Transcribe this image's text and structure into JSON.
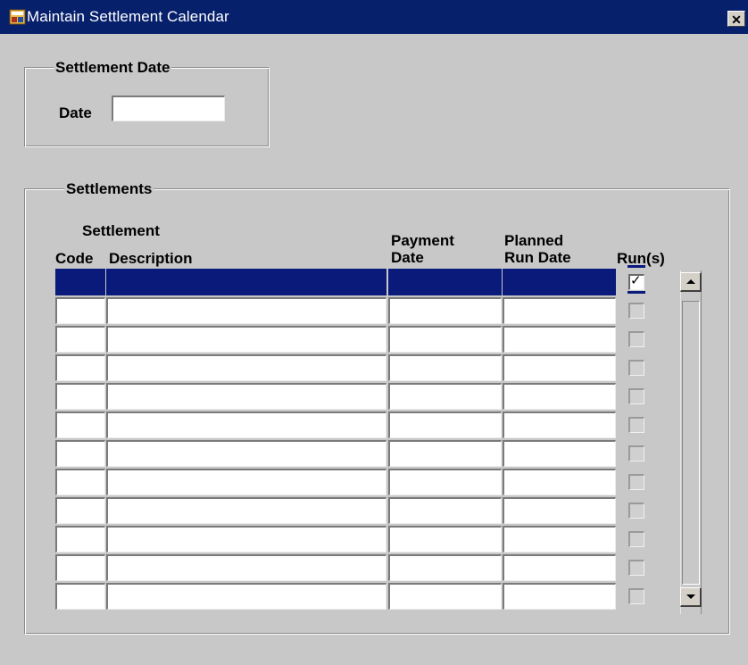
{
  "window": {
    "title": "Maintain Settlement Calendar",
    "close_glyph": "✕",
    "title_bar_color": "#07206b",
    "app_icon": "oracle-forms-app-icon"
  },
  "settlement_date_group": {
    "title": "Settlement Date",
    "date_label": "Date",
    "date_value": ""
  },
  "settlements_group": {
    "title": "Settlements",
    "columns": {
      "settlement_header": "Settlement",
      "code": "Code",
      "description": "Description",
      "payment_date_line1": "Payment",
      "payment_date_line2": "Date",
      "planned_run_line1": "Planned",
      "planned_run_line2": "Run Date",
      "runs": "Run(s)"
    },
    "rows": [
      {
        "code": "",
        "description": "",
        "payment_date": "",
        "planned_run_date": "",
        "runs": true,
        "selected": true
      },
      {
        "code": "",
        "description": "",
        "payment_date": "",
        "planned_run_date": "",
        "runs": false,
        "selected": false
      },
      {
        "code": "",
        "description": "",
        "payment_date": "",
        "planned_run_date": "",
        "runs": false,
        "selected": false
      },
      {
        "code": "",
        "description": "",
        "payment_date": "",
        "planned_run_date": "",
        "runs": false,
        "selected": false
      },
      {
        "code": "",
        "description": "",
        "payment_date": "",
        "planned_run_date": "",
        "runs": false,
        "selected": false
      },
      {
        "code": "",
        "description": "",
        "payment_date": "",
        "planned_run_date": "",
        "runs": false,
        "selected": false
      },
      {
        "code": "",
        "description": "",
        "payment_date": "",
        "planned_run_date": "",
        "runs": false,
        "selected": false
      },
      {
        "code": "",
        "description": "",
        "payment_date": "",
        "planned_run_date": "",
        "runs": false,
        "selected": false
      },
      {
        "code": "",
        "description": "",
        "payment_date": "",
        "planned_run_date": "",
        "runs": false,
        "selected": false
      },
      {
        "code": "",
        "description": "",
        "payment_date": "",
        "planned_run_date": "",
        "runs": false,
        "selected": false
      },
      {
        "code": "",
        "description": "",
        "payment_date": "",
        "planned_run_date": "",
        "runs": false,
        "selected": false
      },
      {
        "code": "",
        "description": "",
        "payment_date": "",
        "planned_run_date": "",
        "runs": false,
        "selected": false
      }
    ],
    "scrollbar": {
      "up_icon": "arrow-up-icon",
      "down_icon": "arrow-down-icon"
    },
    "selection_color": "#0a1a7a"
  }
}
